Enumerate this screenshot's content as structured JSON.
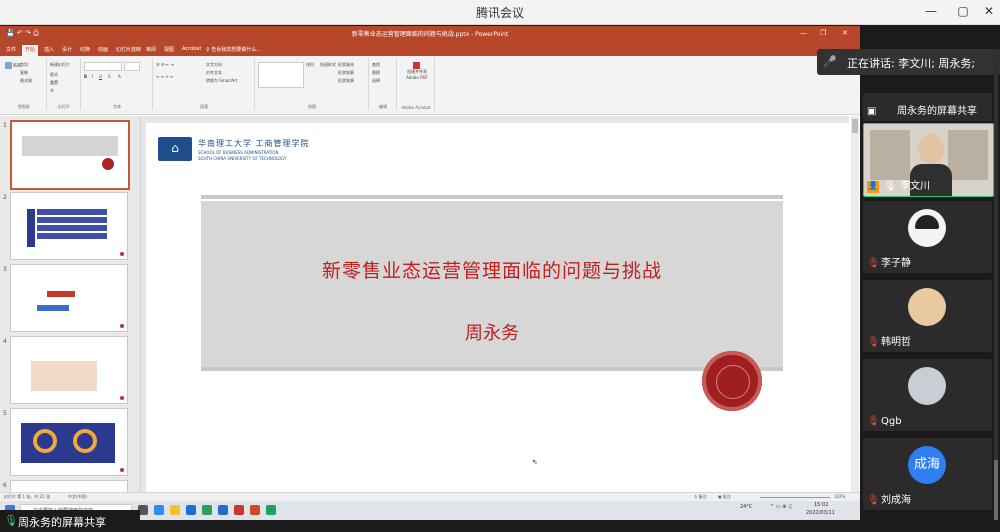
{
  "window": {
    "title": "腾讯会议",
    "minimize": "—",
    "maximize": "▢",
    "close": "✕"
  },
  "powerpoint": {
    "title": "新零售业态运营管理面临的问题与挑战.pptx - PowerPoint",
    "tabs": [
      "文件",
      "开始",
      "插入",
      "设计",
      "切换",
      "动画",
      "幻灯片放映",
      "审阅",
      "视图",
      "Acrobat",
      "♀ 告诉我您想要做什么…"
    ],
    "ribbon_groups": [
      "剪贴板",
      "幻灯片",
      "字体",
      "段落",
      "绘图",
      "编辑",
      "Adobe Acrobat"
    ],
    "ribbon_items": {
      "paste": "粘贴",
      "cut": "剪切",
      "copy": "复制",
      "format": "格式刷",
      "new_slide": "新建幻灯片",
      "layout": "版式",
      "reset": "重置",
      "section": "节",
      "find": "查找",
      "replace": "替换",
      "select": "选择",
      "pdf": "创建并共享 Adobe PDF",
      "arrange": "排列",
      "quick_styles": "快速样式",
      "shape_fill": "形状填充",
      "shape_outline": "形状轮廓",
      "shape_effects": "形状效果",
      "text_dir": "文字方向",
      "align_text": "对齐文本",
      "smartart": "转换为 SmartArt"
    },
    "slide": {
      "logo_cn": "华南理工大学 工商管理学院",
      "logo_en1": "SCHOOL OF BUSINESS ADMINISTRATION",
      "logo_en2": "SOUTH CHINA UNIVERSITY OF TECHNOLOGY",
      "title": "新零售业态运营管理面临的问题与挑战",
      "author": "周永务"
    },
    "thumbnails": [
      "1",
      "2",
      "3",
      "4",
      "5",
      "6"
    ],
    "status": {
      "slide_info": "幻灯片 第 1 张，共 21 张",
      "lang": "中文(中国)",
      "notes": "≙ 备注",
      "comments": "▣ 批注",
      "zoom": "102%"
    }
  },
  "taskbar": {
    "search_placeholder": "在这里输入你要搜索的内容",
    "weather": "24°C",
    "time": "15:02",
    "date": "2022/03/11"
  },
  "share_label": "周永务的屏幕共享",
  "speaking": "正在讲话: 李文川; 周永务;",
  "participants": [
    {
      "name": "周永务的屏幕共享"
    },
    {
      "name": "李文川"
    },
    {
      "name": "李子静"
    },
    {
      "name": "韩明哲"
    },
    {
      "name": "Qgb"
    },
    {
      "name": "刘成海",
      "avatar_text": "成海"
    }
  ]
}
